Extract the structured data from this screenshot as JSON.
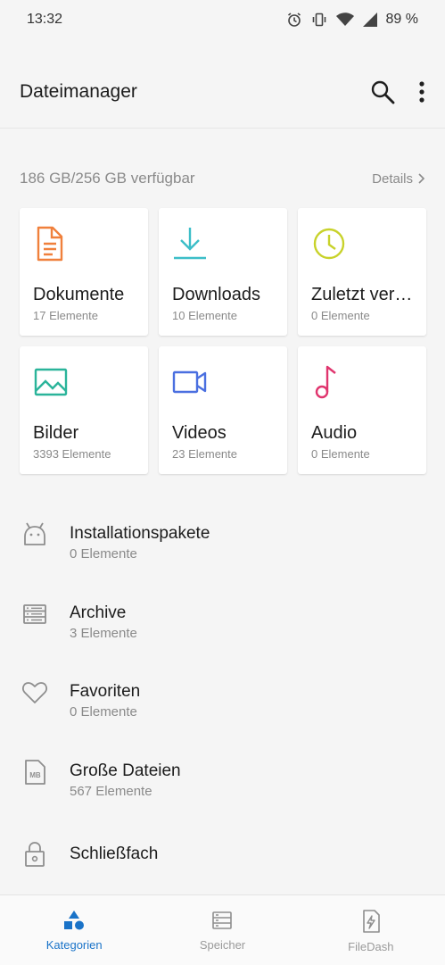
{
  "status_bar": {
    "time": "13:32",
    "battery": "89 %"
  },
  "app_bar": {
    "title": "Dateimanager",
    "search_icon": "search-icon",
    "more_icon": "more-vert-icon"
  },
  "storage": {
    "text": "186 GB/256 GB verfügbar",
    "details_label": "Details"
  },
  "categories": [
    {
      "title": "Dokumente",
      "count": "17 Elemente",
      "icon": "document-icon",
      "color": "#f0803c"
    },
    {
      "title": "Downloads",
      "count": "10 Elemente",
      "icon": "download-icon",
      "color": "#3cbec8"
    },
    {
      "title": "Zuletzt ver…",
      "count": "0 Elemente",
      "icon": "clock-icon",
      "color": "#c8d22a"
    },
    {
      "title": "Bilder",
      "count": "3393 Elemente",
      "icon": "image-icon",
      "color": "#2ab49a"
    },
    {
      "title": "Videos",
      "count": "23 Elemente",
      "icon": "video-icon",
      "color": "#4a6fe0"
    },
    {
      "title": "Audio",
      "count": "0 Elemente",
      "icon": "music-icon",
      "color": "#e0356e"
    }
  ],
  "list": [
    {
      "title": "Installationspakete",
      "count": "0 Elemente",
      "icon": "android-icon"
    },
    {
      "title": "Archive",
      "count": "3 Elemente",
      "icon": "archive-icon"
    },
    {
      "title": "Favoriten",
      "count": "0 Elemente",
      "icon": "heart-icon"
    },
    {
      "title": "Große Dateien",
      "count": "567 Elemente",
      "icon": "large-file-icon",
      "badge": "MB"
    },
    {
      "title": "Schließfach",
      "icon": "lock-icon"
    }
  ],
  "bottom_nav": [
    {
      "label": "Kategorien",
      "icon": "categories-icon",
      "active": true
    },
    {
      "label": "Speicher",
      "icon": "storage-icon",
      "active": false
    },
    {
      "label": "FileDash",
      "icon": "filedash-icon",
      "active": false
    }
  ],
  "colors": {
    "accent": "#1a73c8",
    "muted": "#8a8a8a",
    "icon_gray": "#8e8e8e"
  }
}
